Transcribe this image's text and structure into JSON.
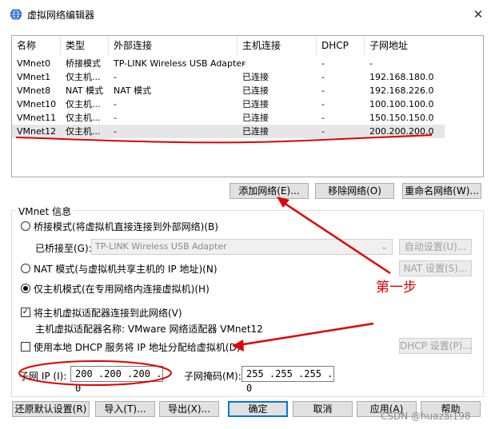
{
  "window": {
    "title": "虚拟网络编辑器",
    "close_glyph": "✕",
    "icon": "globe-network-icon"
  },
  "table": {
    "headers": [
      "名称",
      "类型",
      "外部连接",
      "主机连接",
      "DHCP",
      "子网地址"
    ],
    "rows": [
      [
        "VMnet0",
        "桥接模式",
        "TP-LINK Wireless USB Adapter",
        "-",
        "-",
        "-"
      ],
      [
        "VMnet1",
        "仅主机...",
        "-",
        "已连接",
        "-",
        "192.168.180.0"
      ],
      [
        "VMnet8",
        "NAT 模式",
        "NAT 模式",
        "已连接",
        "-",
        "192.168.226.0"
      ],
      [
        "VMnet10",
        "仅主机...",
        "-",
        "已连接",
        "-",
        "100.100.100.0"
      ],
      [
        "VMnet11",
        "仅主机...",
        "-",
        "已连接",
        "-",
        "150.150.150.0"
      ],
      [
        "VMnet12",
        "仅主机...",
        "-",
        "已连接",
        "-",
        "200.200.200.0"
      ]
    ],
    "selected_row": 5
  },
  "table_buttons": {
    "add": "添加网络(E)...",
    "remove": "移除网络(O)",
    "rename": "重命名网络(W)..."
  },
  "vmnet_info": {
    "group_label": "VMnet 信息",
    "bridge_radio": "桥接模式(将虚拟机直接连接到外部网络)(B)",
    "bridged_to_label": "已桥接至(G):",
    "bridged_to_value": "TP-LINK Wireless USB Adapter",
    "auto_settings": "自动设置(U)...",
    "nat_radio": "NAT 模式(与虚拟机共享主机的 IP 地址)(N)",
    "nat_settings": "NAT 设置(S)...",
    "hostonly_radio": "仅主机模式(在专用网络内连接虚拟机)(H)",
    "connect_adapter_checkbox": "将主机虚拟适配器连接到此网络(V)",
    "adapter_name_label": "主机虚拟适配器名称: VMware 网络适配器 VMnet12",
    "dhcp_checkbox": "使用本地 DHCP 服务将 IP 地址分配给虚拟机(D)",
    "dhcp_settings": "DHCP 设置(P)...",
    "subnet_ip_label": "子网 IP (I):",
    "subnet_ip_value": "200 .200 .200 . 0",
    "subnet_mask_label": "子网掩码(M):",
    "subnet_mask_value": "255 .255 .255 . 0"
  },
  "footer": {
    "restore": "还原默认设置(R)",
    "import": "导入(T)...",
    "export": "导出(X)...",
    "ok": "确定",
    "cancel": "取消",
    "apply": "应用(A)",
    "help": "帮助"
  },
  "annotation": {
    "step_text": "第一步",
    "color": "#e00000"
  },
  "watermark": "CSDN @huazai198"
}
